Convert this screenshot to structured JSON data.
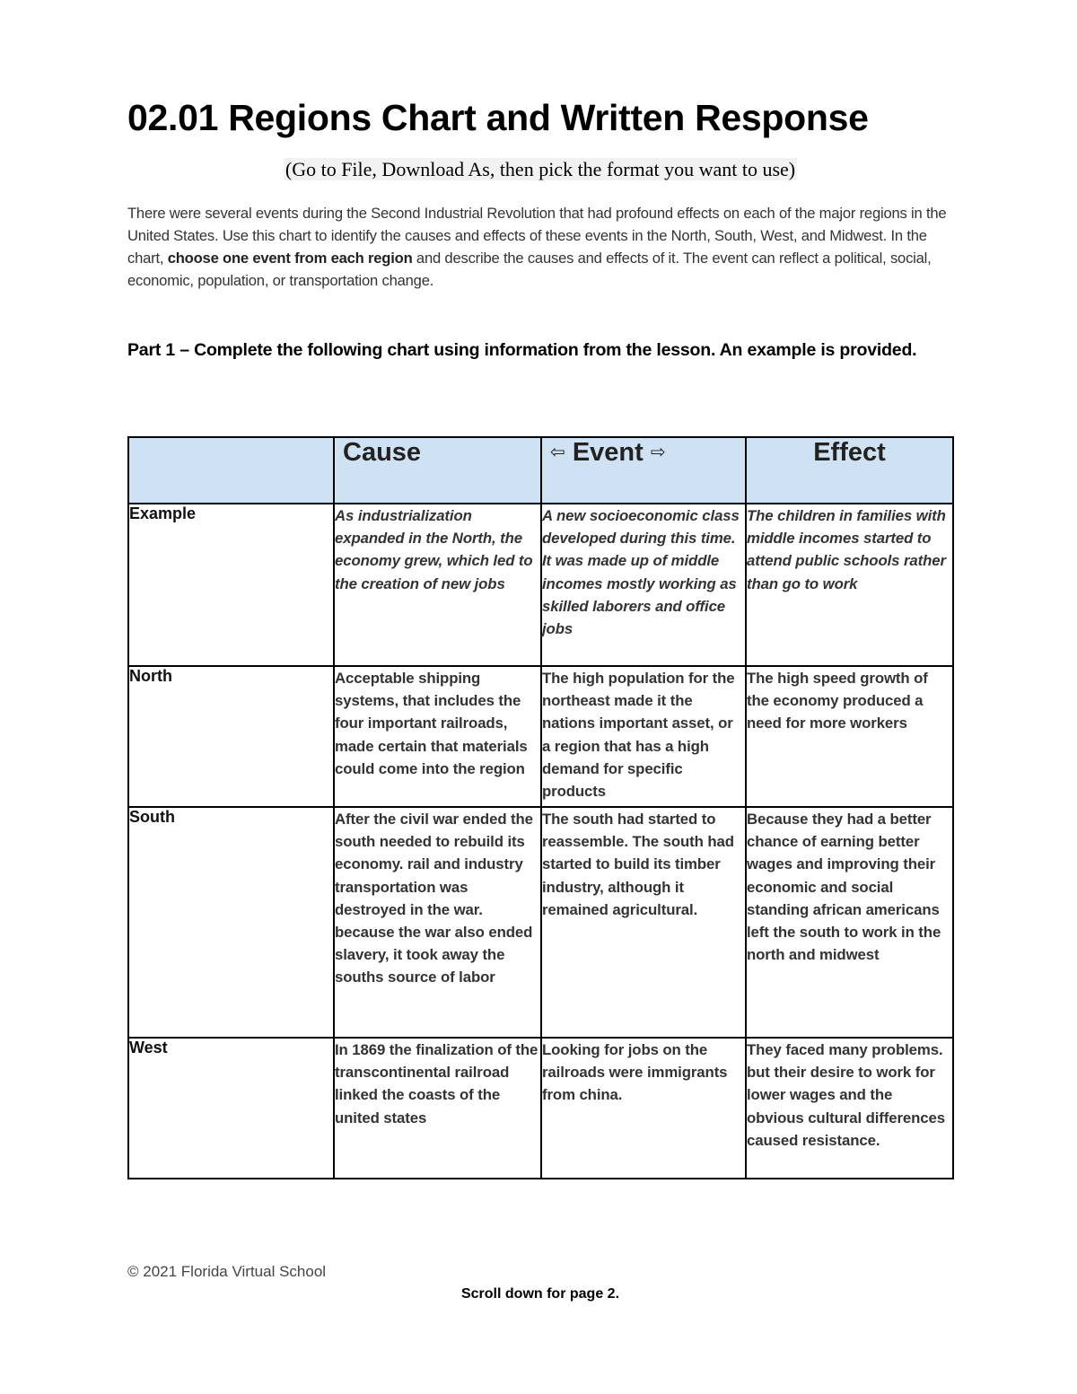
{
  "document": {
    "title": "02.01 Regions Chart and Written Response",
    "subtitle": "(Go to File, Download As, then pick the format you want to use)",
    "intro": {
      "part_a": "There were several events during the Second Industrial Revolution that had profound effects on each of the major regions in the United States. Use this chart to identify the causes and effects of these events in the North, South, West, and Midwest. In the chart, ",
      "part_bold": "choose one event from each region",
      "part_b": " and describe the causes and effects of it. The event can reflect a political, social, economic, population, or transportation change."
    },
    "part1_instruction": "Part 1 – Complete the following chart using information from the lesson. An example is provided."
  },
  "chart": {
    "headers": {
      "blank": "",
      "cause": "Cause",
      "event_left_arrow": "⇦",
      "event": "Event",
      "event_right_arrow": "⇨",
      "effect": "Effect"
    },
    "rows": [
      {
        "region": "Example",
        "cause": "As industrialization expanded in the North, the economy grew, which led to the creation of new jobs",
        "event": "A new socioeconomic class developed during this time.  It was made up of middle incomes mostly working as skilled laborers and office jobs",
        "effect": "The children in families with middle incomes started to attend public schools rather than go to work"
      },
      {
        "region": "North",
        "cause": "Acceptable shipping systems, that includes the four important railroads, made certain that materials could come into the region",
        "event": "The high population for the northeast made it the nations important asset, or a region that has a high demand for specific products",
        "effect": "The high speed growth of the economy produced a need for more workers"
      },
      {
        "region": "South",
        "cause": "After the civil war ended the south needed to rebuild its economy. rail and industry transportation was destroyed in the war. because the war also ended slavery, it took away the souths source of labor",
        "event": "The south had started to reassemble. The south had started to build its timber industry, although it remained agricultural.",
        "effect": "Because they had a better chance of earning better wages and improving their economic and social standing african americans left the south to work in the north and midwest"
      },
      {
        "region": "West",
        "cause": "In 1869 the finalization of the transcontinental railroad linked the coasts of the united states",
        "event": "Looking for jobs on the railroads were immigrants from china.",
        "effect": "They faced many problems. but their desire to work for lower wages and the obvious cultural differences caused resistance."
      }
    ]
  },
  "footer": {
    "copyright": "© 2021 Florida Virtual School",
    "scroll_note": "Scroll down for page 2."
  },
  "colors": {
    "header_fill": "#cfe2f3",
    "border": "#000000"
  }
}
